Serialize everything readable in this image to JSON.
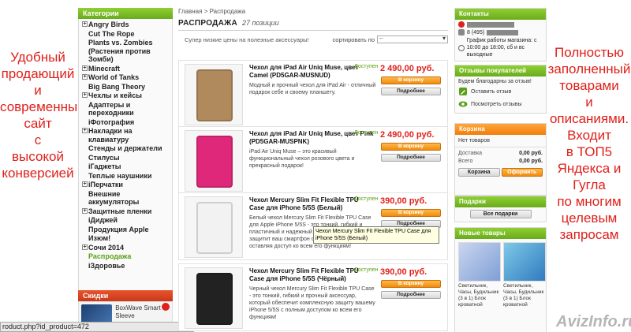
{
  "promo_left": [
    "Удобный",
    "продающий",
    "и",
    "современный",
    "сайт",
    "с",
    "высокой",
    "конверсией"
  ],
  "promo_right": [
    "Полностью",
    "заполненный",
    "товарами",
    "и",
    "описаниями.",
    "Входит",
    "в ТОП5",
    "Яндекса и",
    "Гугла",
    "по многим",
    "целевым",
    "запросам"
  ],
  "categories": {
    "title": "Категории",
    "items": [
      {
        "label": "Angry Birds",
        "expandable": true
      },
      {
        "label": "Cut The Rope",
        "expandable": false
      },
      {
        "label": "Plants vs. Zombies (Растения против Зомби)",
        "expandable": false
      },
      {
        "label": "Minecraft",
        "expandable": true
      },
      {
        "label": "World of Tanks",
        "expandable": true
      },
      {
        "label": "Big Bang Theory",
        "expandable": false
      },
      {
        "label": "Чехлы и кейсы",
        "expandable": true
      },
      {
        "label": "Адаптеры и переходники",
        "expandable": false
      },
      {
        "label": "iФотография",
        "expandable": false
      },
      {
        "label": "Накладки на клавиатуру",
        "expandable": true
      },
      {
        "label": "Стенды и держатели",
        "expandable": false
      },
      {
        "label": "Стилусы",
        "expandable": false
      },
      {
        "label": "iГаджеты",
        "expandable": false
      },
      {
        "label": "Теплые наушники",
        "expandable": false
      },
      {
        "label": "iПерчатки",
        "expandable": true
      },
      {
        "label": "Внешние аккумуляторы",
        "expandable": false
      },
      {
        "label": "Защитные пленки",
        "expandable": true
      },
      {
        "label": "iДиджей",
        "expandable": false
      },
      {
        "label": "Продукция Apple",
        "expandable": false
      },
      {
        "label": "Изюм!",
        "expandable": false
      },
      {
        "label": "Сочи 2014",
        "expandable": true
      },
      {
        "label": "Распродажа",
        "expandable": false,
        "active": true
      },
      {
        "label": "iЗдоровье",
        "expandable": false
      }
    ]
  },
  "discounts": {
    "title": "Скидки",
    "item_text": "BoxWave Smart Sleeve"
  },
  "status_bar": "roduct.php?id_product=472",
  "breadcrumb": {
    "home": "Главная",
    "sep": ">",
    "current": "Распродажа"
  },
  "sale": {
    "title": "РАСПРОДАЖА",
    "count": "27 позиции",
    "subtitle": "Супер низкие цены на полезные аксессуары!",
    "sort_label": "сортировать по",
    "sort_value": "--"
  },
  "products": [
    {
      "name": "Чехол для iPad Air Uniq Muse, цвет Camel (PD5GAR-MUSNUD)",
      "desc": "Модный и прочный чехол для iPad Air - отличный подарок себе и своему планшету.",
      "avail": "Доступен",
      "price": "2 490,00 руб.",
      "cart": "В корзину",
      "more": "Подробнее",
      "img_color": "#b08a5c"
    },
    {
      "name": "Чехол для iPad Air Uniq Muse, цвет Pink (PD5GAR-MUSPNK)",
      "desc": "iPad Air Uniq Muse – это красивый функциональный чехол розового цвета и прекрасный подарок!",
      "avail": "Доступен",
      "price": "2 490,00 руб.",
      "cart": "В корзину",
      "more": "Подробнее",
      "img_color": "#e0287a"
    },
    {
      "name": "Чехол Mercury Slim Fit Flexible TPU Case для iPhone 5/5S (Белый)",
      "desc": "Белый чехол Mercury Slim Fit Flexible TPU Case для Apple iPhone 5/5S - это тонкий, гибкий и пластичный и надежный аксессуар, который защитит ваш смартфон от повреждений, оставляя доступ ко всем его функциям!",
      "avail": "Доступен",
      "price": "390,00 руб.",
      "cart": "В корзину",
      "more": "Подробнее",
      "img_color": "#f2f2f2"
    },
    {
      "name": "Чехол Mercury Slim Fit Flexible TPU Case для iPhone 5/5S (Чёрный)",
      "desc": "Черный чехол Mercury Slim Fit Flexible TPU Case - это тонкий, гибкий и прочный аксессуар, который обеспечит комплексную защиту вашему iPhone 5/5S с полным доступом ко всем его функциям!",
      "avail": "Доступен",
      "price": "390,00 руб.",
      "cart": "В корзину",
      "more": "Подробнее",
      "img_color": "#222222"
    }
  ],
  "tooltip": "Чехол Mercury Slim Fit Flexible TPU Case для iPhone 5/5S (Белый)",
  "contacts": {
    "title": "Контакты",
    "phone_prefix": "8 (495)",
    "schedule": "График работы магазина: с 10:00 до 18:00, сб и вс выходные"
  },
  "reviews": {
    "title": "Отзывы покупателей",
    "thanks": "Будем благодарны за отзыв!",
    "write": "Оставить отзыв",
    "view": "Посмотреть отзывы"
  },
  "cart": {
    "title": "Корзина",
    "empty": "Нет товаров",
    "delivery_label": "Доставка",
    "delivery_value": "0,00 руб.",
    "total_label": "Всего",
    "total_value": "0,00 руб.",
    "cart_button": "Корзина",
    "checkout_button": "Оформить"
  },
  "gifts": {
    "title": "Подарки",
    "all_button": "Все подарки"
  },
  "new_products": {
    "title": "Новые товары",
    "items": [
      {
        "text": "Светильник, Часы, Будильник (3 в 1) Блок кроватной"
      },
      {
        "text": "Светильник, Часы, Будильник (3 в 1) Блок кроватной"
      }
    ]
  },
  "watermark": "AvizInfo.ru",
  "colors": {
    "green": "#6aab1c",
    "orange": "#f08c0e",
    "red": "#e0201a"
  }
}
